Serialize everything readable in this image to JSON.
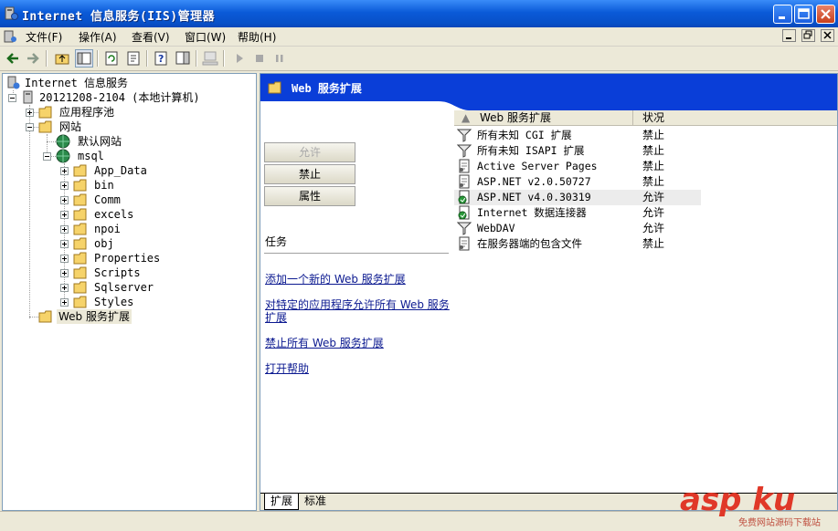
{
  "window": {
    "title": "Internet 信息服务(IIS)管理器"
  },
  "menu": [
    "文件(F)",
    "操作(A)",
    "查看(V)",
    "窗口(W)",
    "帮助(H)"
  ],
  "tree": {
    "root": "Internet 信息服务",
    "computer": "20121208-2104 (本地计算机)",
    "app_pools": "应用程序池",
    "websites": "网站",
    "default_site": "默认网站",
    "msql": "msql",
    "folders": [
      "App_Data",
      "bin",
      "Comm",
      "excels",
      "npoi",
      "obj",
      "Properties",
      "Scripts",
      "Sqlserver",
      "Styles"
    ],
    "web_ext": "Web 服务扩展"
  },
  "right": {
    "header": "Web 服务扩展",
    "buttons": {
      "allow": "允许",
      "deny": "禁止",
      "properties": "属性"
    },
    "tasks_label": "任务",
    "links": [
      "添加一个新的 Web 服务扩展",
      "对特定的应用程序允许所有 Web 服务扩展",
      "禁止所有 Web 服务扩展",
      "打开帮助"
    ],
    "columns": {
      "name": "Web 服务扩展",
      "status": "状况"
    },
    "rows": [
      {
        "name": "所有未知 CGI 扩展",
        "status": "禁止",
        "icon": "filter-icon"
      },
      {
        "name": "所有未知 ISAPI 扩展",
        "status": "禁止",
        "icon": "filter-icon"
      },
      {
        "name": "Active Server Pages",
        "status": "禁止",
        "icon": "ext-doc-icon"
      },
      {
        "name": "ASP.NET v2.0.50727",
        "status": "禁止",
        "icon": "ext-doc-icon"
      },
      {
        "name": "ASP.NET v4.0.30319",
        "status": "允许",
        "icon": "ext-allowed-icon"
      },
      {
        "name": "Internet 数据连接器",
        "status": "允许",
        "icon": "ext-allowed-icon"
      },
      {
        "name": "WebDAV",
        "status": "允许",
        "icon": "filter-icon"
      },
      {
        "name": "在服务器端的包含文件",
        "status": "禁止",
        "icon": "ext-doc-icon"
      }
    ],
    "tabs": [
      "扩展",
      "标准"
    ]
  },
  "watermark": {
    "brand": "asp ku",
    "sub": "免费网站源码下载站"
  }
}
